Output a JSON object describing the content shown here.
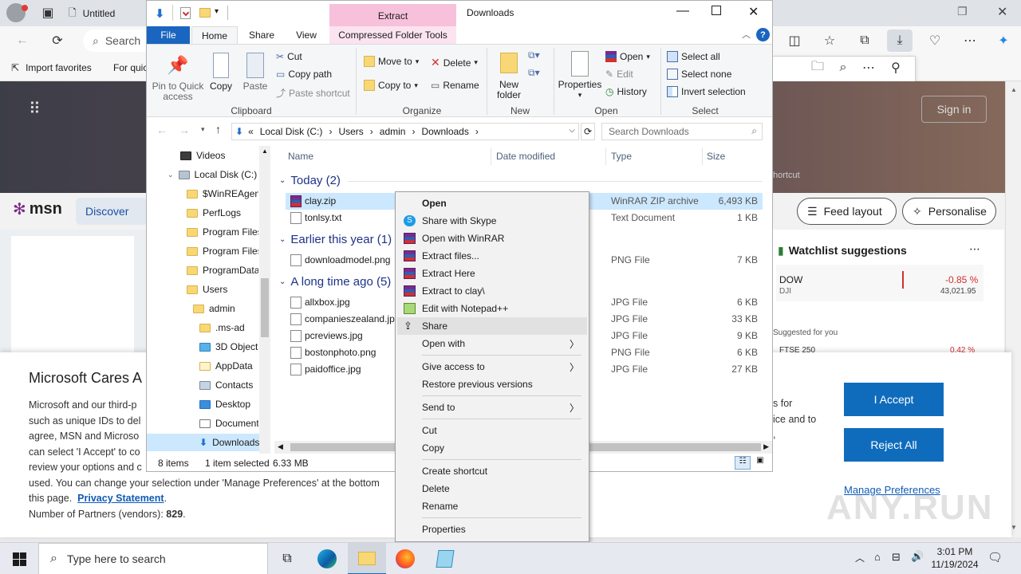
{
  "edge": {
    "search_partial": "Search",
    "favorites": {
      "import_label": "Import favorites",
      "quick_partial": "For quic"
    },
    "msn": {
      "brand": "msn",
      "discover": "Discover",
      "feed_layout": "Feed layout",
      "personalise": "Personalise",
      "sign_in": "Sign in",
      "shortcut_partial": "hortcut",
      "watchlist_title": "Watchlist suggestions",
      "stock_name": "DOW",
      "stock_sub": "DJI",
      "stock_change": "-0.85 %",
      "stock_value": "43,021.95",
      "suggested": "Suggested for you",
      "stock2_partial": "FTSE 250",
      "stock2_change_partial": "0.42 %"
    },
    "consent": {
      "title": "Microsoft Cares A",
      "text_lines": [
        "Microsoft and our third-p",
        "such as unique IDs to del",
        "agree, MSN and Microso",
        "can select 'I Accept' to co",
        "review your options and c"
      ],
      "line6": "used.  You can change your selection under 'Manage Preferences' at the bottom",
      "line7_prefix": "this page.",
      "privacy_link": "Privacy Statement",
      "line8_prefix": "Number of Partners (vendors):",
      "partners_count": "829",
      "right_fragments": [
        "s for",
        "ice and to",
        ","
      ],
      "accept": "I Accept",
      "reject": "Reject All",
      "manage": "Manage Preferences"
    }
  },
  "explorer": {
    "title": "Downloads",
    "contextual_tab": "Extract",
    "tabs": [
      "File",
      "Home",
      "Share",
      "View",
      "Compressed Folder Tools"
    ],
    "ribbon": {
      "clipboard": {
        "label": "Clipboard",
        "pin": "Pin to Quick access",
        "copy": "Copy",
        "paste": "Paste",
        "cut": "Cut",
        "copy_path": "Copy path",
        "paste_shortcut": "Paste shortcut"
      },
      "organize": {
        "label": "Organize",
        "move_to": "Move to",
        "copy_to": "Copy to",
        "delete": "Delete",
        "rename": "Rename"
      },
      "new": {
        "label": "New",
        "new_folder": "New folder"
      },
      "open": {
        "label": "Open",
        "properties": "Properties",
        "open": "Open",
        "edit": "Edit",
        "history": "History"
      },
      "select": {
        "label": "Select",
        "select_all": "Select all",
        "select_none": "Select none",
        "invert": "Invert selection"
      }
    },
    "address": {
      "prefix": "«",
      "crumbs": [
        "Local Disk (C:)",
        "Users",
        "admin",
        "Downloads"
      ],
      "search_placeholder": "Search Downloads"
    },
    "nav": [
      "Videos",
      "Local Disk (C:)",
      "$WinREAgent",
      "PerfLogs",
      "Program Files",
      "Program Files",
      "ProgramData",
      "Users",
      "admin",
      ".ms-ad",
      "3D Objects",
      "AppData",
      "Contacts",
      "Desktop",
      "Documents",
      "Downloads"
    ],
    "columns": [
      "Name",
      "Date modified",
      "Type",
      "Size"
    ],
    "groups": [
      {
        "label": "Today (2)",
        "files": [
          {
            "name": "clay.zip",
            "type": "WinRAR ZIP archive",
            "size": "6,493 KB",
            "selected": true,
            "icon": "winrar-icon"
          },
          {
            "name": "tonlsy.txt",
            "type": "Text Document",
            "size": "1 KB",
            "icon": "text-file-icon"
          }
        ]
      },
      {
        "label": "Earlier this year (1)",
        "files": [
          {
            "name": "downloadmodel.png",
            "type": "PNG File",
            "size": "7 KB",
            "icon": "image-file-icon"
          }
        ]
      },
      {
        "label": "A long time ago (5)",
        "files": [
          {
            "name": "allxbox.jpg",
            "type": "JPG File",
            "size": "6 KB",
            "icon": "image-file-icon"
          },
          {
            "name": "companieszealand.jpg",
            "type": "JPG File",
            "size": "33 KB",
            "icon": "image-file-icon"
          },
          {
            "name": "pcreviews.jpg",
            "type": "JPG File",
            "size": "9 KB",
            "icon": "image-file-icon"
          },
          {
            "name": "bostonphoto.png",
            "type": "PNG File",
            "size": "6 KB",
            "icon": "image-file-icon"
          },
          {
            "name": "paidoffice.jpg",
            "type": "JPG File",
            "size": "27 KB",
            "icon": "image-file-icon"
          }
        ]
      }
    ],
    "status": {
      "items": "8 items",
      "selected": "1 item selected",
      "size": "6.33 MB"
    }
  },
  "context_menu": {
    "items": [
      {
        "label": "Open",
        "bold": true
      },
      {
        "label": "Share with Skype",
        "icon": "skype-icon"
      },
      {
        "label": "Open with WinRAR",
        "icon": "winrar-icon"
      },
      {
        "label": "Extract files...",
        "icon": "winrar-icon"
      },
      {
        "label": "Extract Here",
        "icon": "winrar-icon"
      },
      {
        "label": "Extract to clay\\",
        "icon": "winrar-icon"
      },
      {
        "label": "Edit with Notepad++",
        "icon": "notepadpp-icon"
      },
      {
        "label": "Share",
        "icon": "share-icon"
      },
      {
        "label": "Open with",
        "submenu": true
      },
      {
        "label": "Give access to",
        "submenu": true
      },
      {
        "label": "Restore previous versions"
      },
      {
        "label": "Send to",
        "submenu": true
      },
      {
        "label": "Cut"
      },
      {
        "label": "Copy"
      },
      {
        "label": "Create shortcut"
      },
      {
        "label": "Delete"
      },
      {
        "label": "Rename"
      },
      {
        "label": "Properties"
      }
    ]
  },
  "taskbar": {
    "search_placeholder": "Type here to search",
    "time": "3:01 PM",
    "date": "11/19/2024"
  },
  "watermark": "ANY.RUN",
  "colors": {
    "accent": "#0f6cbd",
    "selection": "#cce8ff",
    "extract_tab": "#f7c1dc"
  }
}
